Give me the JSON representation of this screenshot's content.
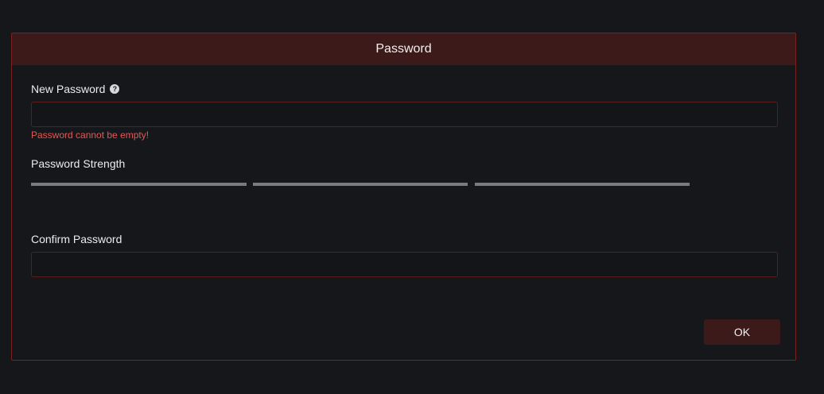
{
  "dialog": {
    "title": "Password",
    "new_password": {
      "label": "New Password",
      "help_icon": "question-circle-icon",
      "value": "",
      "error": "Password cannot be empty!"
    },
    "strength": {
      "label": "Password Strength",
      "segments": 3,
      "filled": 0
    },
    "confirm_password": {
      "label": "Confirm Password",
      "value": ""
    },
    "ok_label": "OK"
  },
  "colors": {
    "accent": "#3b1a19",
    "border": "#7a221f",
    "error": "#e05a56",
    "strength_empty": "#7b7b7b"
  }
}
